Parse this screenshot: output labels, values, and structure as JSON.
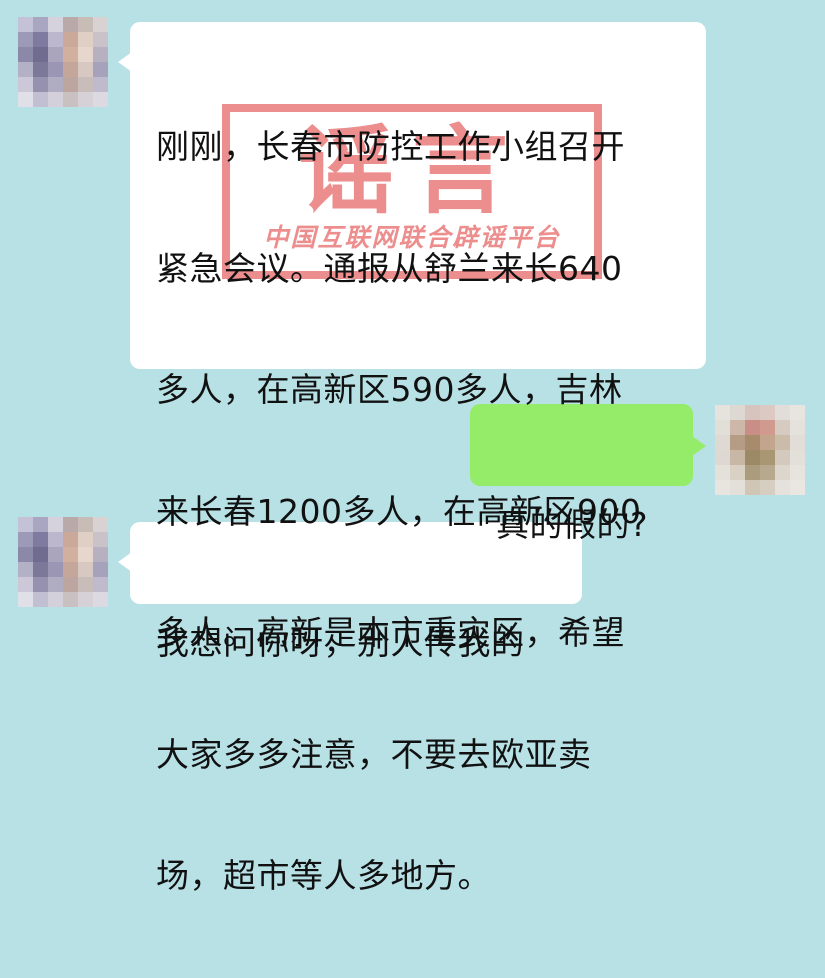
{
  "colors": {
    "background": "#b8e1e6",
    "incoming_bubble": "#ffffff",
    "outgoing_bubble": "#95ec69",
    "stamp": "#de3232"
  },
  "messages": [
    {
      "direction": "incoming",
      "avatar": "pixelated-avatar",
      "lines": [
        "刚刚，长春市防控工作小组召开",
        "紧急会议。通报从舒兰来长640",
        "多人，在高新区590多人，吉林",
        "来长春1200多人，在高新区900",
        "多人。高新是本市重灾区，希望",
        "大家多多注意，不要去欧亚卖",
        "场，超市等人多地方。"
      ],
      "stamp": {
        "main": "谣言",
        "sub": "中国互联网联合辟谣平台"
      }
    },
    {
      "direction": "outgoing",
      "avatar": "pixelated-avatar",
      "lines": [
        "真的假的?"
      ]
    },
    {
      "direction": "incoming",
      "avatar": "pixelated-avatar",
      "lines": [
        "我想问你呀，别人传我的"
      ]
    }
  ]
}
